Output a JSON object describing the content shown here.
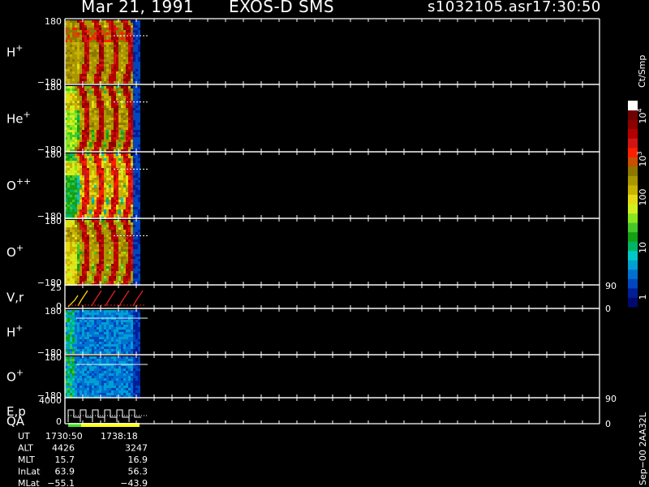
{
  "header": {
    "date": "Mar 21, 1991",
    "instrument": "EXOS-D SMS",
    "file": "s1032105.asr",
    "time": "17:30:50"
  },
  "panels": [
    {
      "label": "H",
      "sup": "+",
      "top": "180",
      "bottom": "−180",
      "right_top": "",
      "right_bottom": ""
    },
    {
      "label": "He",
      "sup": "+",
      "top": "180",
      "bottom": "−180",
      "right_top": "",
      "right_bottom": ""
    },
    {
      "label": "O",
      "sup": "++",
      "top": "180",
      "bottom": "−180",
      "right_top": "",
      "right_bottom": ""
    },
    {
      "label": "O",
      "sup": "+",
      "top": "180",
      "bottom": "−180",
      "right_top": "",
      "right_bottom": ""
    },
    {
      "label": "V,r",
      "sup": "",
      "top": "25",
      "bottom": "0",
      "right_top": "90",
      "right_bottom": "0"
    },
    {
      "label": "H",
      "sup": "+",
      "top": "180",
      "bottom": "−180",
      "right_top": "",
      "right_bottom": ""
    },
    {
      "label": "O",
      "sup": "+",
      "top": "180",
      "bottom": "−180",
      "right_top": "",
      "right_bottom": ""
    },
    {
      "label": "E,p",
      "sup": "",
      "top": "4000",
      "bottom": "0",
      "right_top": "90",
      "right_bottom": "0"
    }
  ],
  "qa_label": "QA",
  "colorbar": {
    "unit": "Ct/Smp",
    "ticks": [
      {
        "base": "10",
        "exp": "4"
      },
      {
        "base": "10",
        "exp": "3"
      },
      {
        "base": "100",
        "exp": ""
      },
      {
        "base": "10",
        "exp": ""
      },
      {
        "base": "1",
        "exp": ""
      }
    ],
    "colors": [
      "#000a6e",
      "#001e96",
      "#0046be",
      "#0070d2",
      "#00a0d2",
      "#00c8c8",
      "#00b464",
      "#14a014",
      "#46c828",
      "#8ce61e",
      "#d2f01e",
      "#e6dc14",
      "#c8b400",
      "#aa9600",
      "#8c7800",
      "#c85000",
      "#ff1e00",
      "#d21414",
      "#b40000",
      "#8c0000",
      "#6e0000",
      "#ffffff"
    ]
  },
  "footer": {
    "headers": [
      "UT",
      "1730:50",
      "1738:18"
    ],
    "rows": [
      [
        "ALT",
        "4426",
        "3247"
      ],
      [
        "MLT",
        "15.7",
        "16.9"
      ],
      [
        "InLat",
        "63.9",
        "56.3"
      ],
      [
        "MLat",
        "−55.1",
        "−43.9"
      ]
    ]
  },
  "version": "Sep−00 2AA32L",
  "chart_data": {
    "type": "heatmap",
    "title": "Mar 21, 1991   EXOS-D SMS",
    "colorbar_label": "Ct/Smp",
    "colorbar_scale": "log",
    "colorbar_range": [
      1,
      10000
    ],
    "x_time_range": [
      "1730:50",
      "1738:18"
    ],
    "series": [
      {
        "name": "H+",
        "ylim": [
          -180,
          180
        ]
      },
      {
        "name": "He+",
        "ylim": [
          -180,
          180
        ]
      },
      {
        "name": "O++",
        "ylim": [
          -180,
          180
        ]
      },
      {
        "name": "O+",
        "ylim": [
          -180,
          180
        ]
      },
      {
        "name": "V,r",
        "ylim": [
          0,
          25
        ],
        "right_ylim": [
          0,
          90
        ]
      },
      {
        "name": "H+",
        "ylim": [
          -180,
          180
        ]
      },
      {
        "name": "O+",
        "ylim": [
          -180,
          180
        ]
      },
      {
        "name": "E,p",
        "ylim": [
          0,
          4000
        ],
        "right_ylim": [
          0,
          90
        ]
      }
    ]
  }
}
